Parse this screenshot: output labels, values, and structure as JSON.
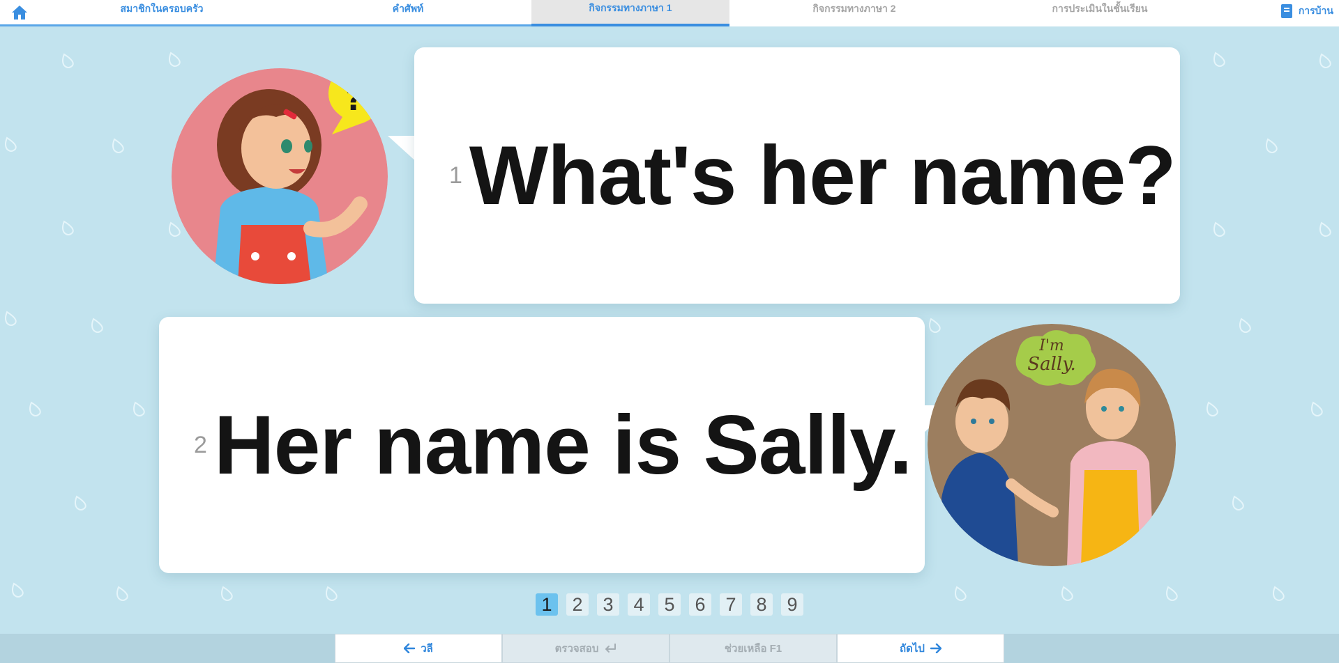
{
  "nav": {
    "tabs": [
      {
        "label": "สมาชิกในครอบครัว",
        "state": "enabled"
      },
      {
        "label": "คำศัพท์",
        "state": "enabled"
      },
      {
        "label": "กิจกรรมทางภาษา 1",
        "state": "active"
      },
      {
        "label": "กิจกรรมทางภาษา 2",
        "state": "disabled"
      },
      {
        "label": "การประเมินในชั้นเรียน",
        "state": "disabled"
      }
    ],
    "homework_label": "การบ้าน"
  },
  "dialog": [
    {
      "number": "1",
      "sentence": "What's her name?",
      "speaker_badge": "?"
    },
    {
      "number": "2",
      "sentence": "Her name is Sally.",
      "speaker_badge": "I'm Sally."
    }
  ],
  "pager": {
    "pages": [
      "1",
      "2",
      "3",
      "4",
      "5",
      "6",
      "7",
      "8",
      "9"
    ],
    "current": "1"
  },
  "controls": {
    "back_label": "วลี",
    "check_label": "ตรวจสอบ",
    "help_label": "ช่วยเหลือ F1",
    "next_label": "ถัดไป"
  },
  "colors": {
    "background": "#c2e3ee",
    "accent": "#3a8ee0",
    "current_page": "#6cc2ee"
  }
}
